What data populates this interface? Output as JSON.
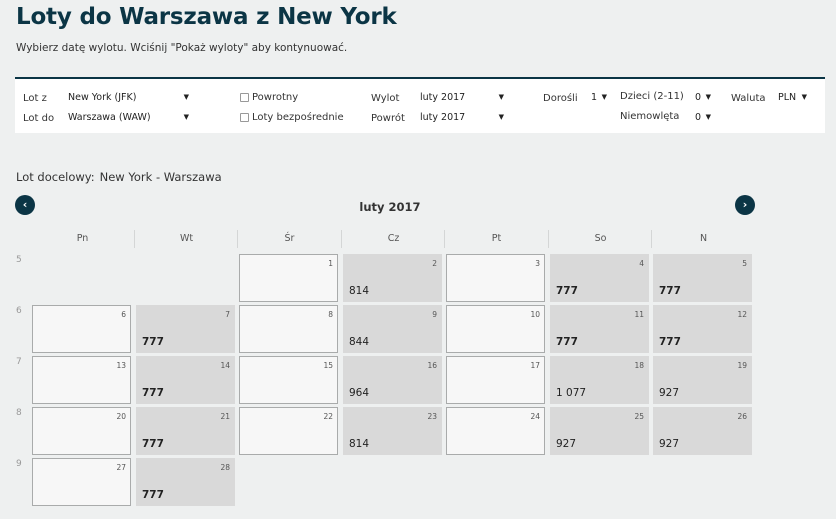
{
  "page": {
    "title": "Loty do Warszawa z New York",
    "subtitle": "Wybierz datę wylotu. Wciśnij \"Pokaż wyloty\" aby kontynuować."
  },
  "form": {
    "from_label": "Lot z",
    "from_value": "New York (JFK)",
    "to_label": "Lot do",
    "to_value": "Warszawa (WAW)",
    "return_label": "Powrotny",
    "return_checked": false,
    "direct_label": "Loty bezpośrednie",
    "direct_checked": false,
    "depart_label": "Wylot",
    "depart_value": "luty 2017",
    "return_date_label": "Powrót",
    "return_date_value": "luty 2017",
    "adults_label": "Dorośli",
    "adults_value": "1",
    "children_label": "Dzieci (2-11)",
    "children_value": "0",
    "infants_label": "Niemowlęta",
    "infants_value": "0",
    "currency_label": "Waluta",
    "currency_value": "PLN"
  },
  "calendar": {
    "destination_label": "Lot docelowy:",
    "destination_value": "New York - Warszawa",
    "month_label": "luty 2017",
    "prev_icon": "chevron-left-icon",
    "next_icon": "chevron-right-icon",
    "weekdays": [
      "Pn",
      "Wt",
      "Śr",
      "Cz",
      "Pt",
      "So",
      "N"
    ],
    "weeks": [
      {
        "week": "5",
        "days": [
          null,
          null,
          {
            "day": "1",
            "price": ""
          },
          {
            "day": "2",
            "price": "814"
          },
          {
            "day": "3",
            "price": ""
          },
          {
            "day": "4",
            "price": "777"
          },
          {
            "day": "5",
            "price": "777"
          }
        ]
      },
      {
        "week": "6",
        "days": [
          {
            "day": "6",
            "price": ""
          },
          {
            "day": "7",
            "price": "777"
          },
          {
            "day": "8",
            "price": ""
          },
          {
            "day": "9",
            "price": "844"
          },
          {
            "day": "10",
            "price": ""
          },
          {
            "day": "11",
            "price": "777"
          },
          {
            "day": "12",
            "price": "777"
          }
        ]
      },
      {
        "week": "7",
        "days": [
          {
            "day": "13",
            "price": ""
          },
          {
            "day": "14",
            "price": "777"
          },
          {
            "day": "15",
            "price": ""
          },
          {
            "day": "16",
            "price": "964"
          },
          {
            "day": "17",
            "price": ""
          },
          {
            "day": "18",
            "price": "1 077"
          },
          {
            "day": "19",
            "price": "927"
          }
        ]
      },
      {
        "week": "8",
        "days": [
          {
            "day": "20",
            "price": ""
          },
          {
            "day": "21",
            "price": "777"
          },
          {
            "day": "22",
            "price": ""
          },
          {
            "day": "23",
            "price": "814"
          },
          {
            "day": "24",
            "price": ""
          },
          {
            "day": "25",
            "price": "927"
          },
          {
            "day": "26",
            "price": "927"
          }
        ]
      },
      {
        "week": "9",
        "days": [
          {
            "day": "27",
            "price": ""
          },
          {
            "day": "28",
            "price": "777"
          },
          null,
          null,
          null,
          null,
          null
        ]
      }
    ],
    "lowest_price": "777"
  }
}
